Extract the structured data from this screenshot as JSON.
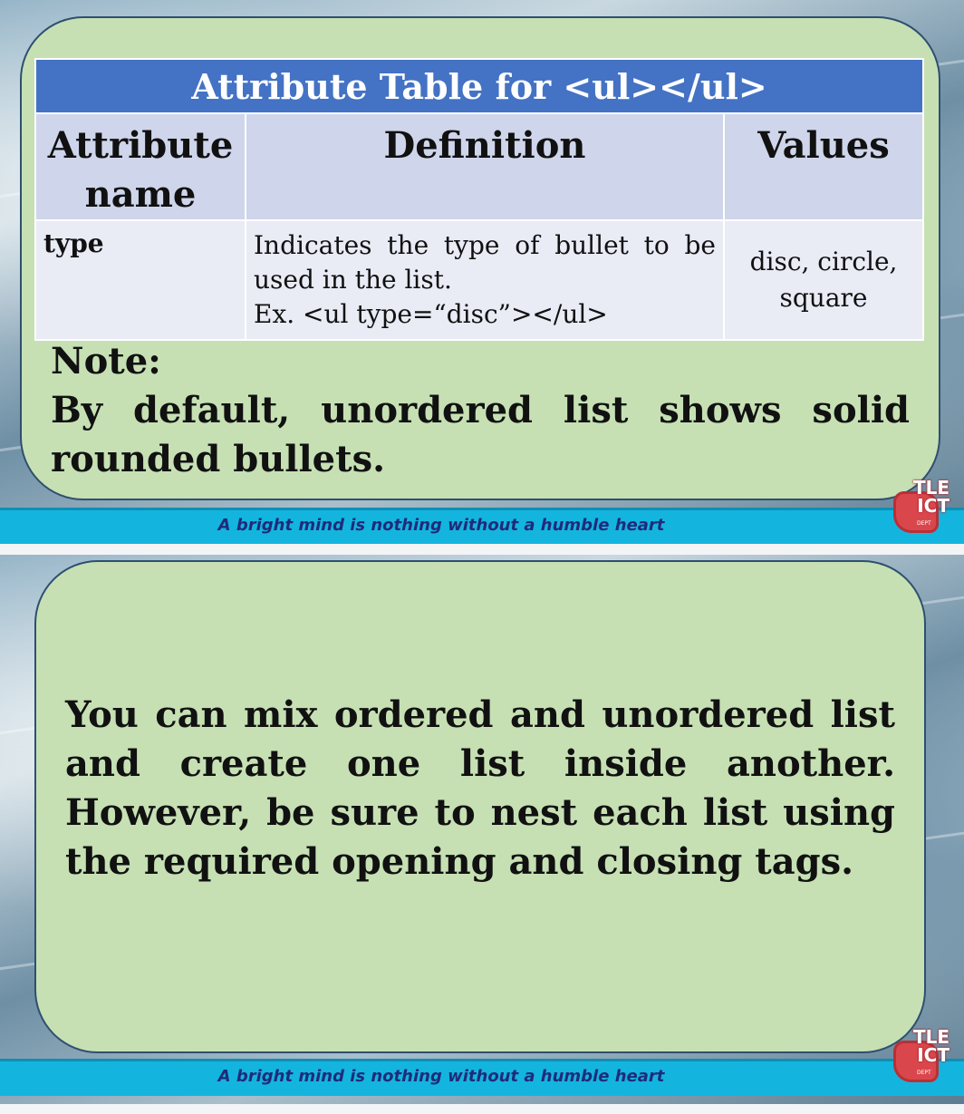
{
  "slide1": {
    "table": {
      "title": "Attribute Table for <ul></ul>",
      "headers": [
        "Attribute name",
        "Definition",
        "Values"
      ],
      "rows": [
        {
          "attribute": "type",
          "definition_line1": "Indicates the type of bullet to be used in the list.",
          "definition_line2": "Ex.  <ul type=“disc”></ul>",
          "values": "disc, circle, square"
        }
      ]
    },
    "note_label": "Note:",
    "note_text": "By default, unordered list shows solid rounded bullets.",
    "footer": "A bright mind is nothing without a humble heart"
  },
  "slide2": {
    "paragraph": "You can mix ordered and unordered list and create one list inside another. However, be sure to nest each list using the required opening and closing tags.",
    "footer": "A bright mind is nothing without a humble heart"
  },
  "logo": {
    "text_top": "TLE",
    "text_bottom": "ICT",
    "sub": "DEPT"
  },
  "colors": {
    "card_green": "#c6e0b4",
    "table_title_blue": "#4472c4",
    "footer_cyan": "#13b5df",
    "footer_text": "#1f2b7a",
    "logo_red": "#d9474d"
  }
}
